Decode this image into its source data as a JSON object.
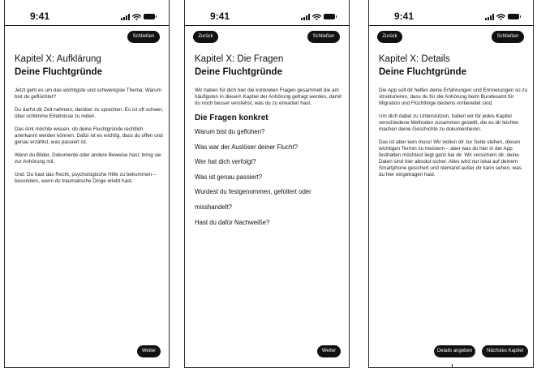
{
  "status": {
    "time": "9:41"
  },
  "screens": [
    {
      "close_label": "Schließen",
      "chapter": "Kapitel X: Aufklärung",
      "title": "Deine Fluchtgründe",
      "paragraphs": [
        "Jetzt geht es um das wichtigste und schwierigste Thema: Warum bist du geflüchtet?",
        "Du darfst dir Zeit nehmen, darüber zu sprechen. Es ist oft schwer, über schlimme Erlebnisse zu reden.",
        "Das Amt möchte wissen, ob deine Fluchtgründe rechtlich anerkannt werden können. Dafür ist es wichtig, dass du offen und genau erzählst, was passiert ist.",
        "Wenn du Bilder, Dokumente oder andere Beweise hast, bring sie zur Anhörung mit.",
        "Und: Du hast das Recht, psychologische Hilfe zu bekommen – besonders, wenn du traumatische Dinge erlebt hast."
      ],
      "next_label": "Weiter"
    },
    {
      "back_label": "Zurück",
      "close_label": "Schließen",
      "chapter": "Kapitel X: Die Fragen",
      "title": "Deine Fluchtgründe",
      "paragraphs": [
        "Wir haben für dich hier die konkreten Fragen gesammelt die am häufigsten in diesem Kaptiel der Anhörung gefragt werden, damit du noch besser verstehst, was du zu erwarten hast."
      ],
      "subheading": "Die Fragen konkret",
      "questions": [
        "Warum bist du geflohen?",
        "Was war der Auslöser deiner Flucht?",
        "Wer hat dich verfolgt?",
        "Was ist genau passiert?",
        "Wurdest du festgenommen, gefoltert oder",
        "misshandelt?",
        "Hast du dafür Nachweiße?"
      ],
      "next_label": "Weiter"
    },
    {
      "back_label": "Zurück",
      "close_label": "Schließen",
      "chapter": "Kapitel X: Details",
      "title": "Deine Fluchtgründe",
      "paragraphs": [
        "Die App soll dir helfen deine Erfahrungen und Erinnerungen so zu strukturieren, dass du für die Anhörung beim Bundesamt für Migration und Flüchtlinge bestens vorbereitet sind.",
        "Um dich dabei zu Unterstützen, haben wir für jedes Kapitel verschiedene Methoden zusammen gestellt, die es dir leichter machen deine Geschichte zu dokumentieren.",
        "Das ist aber kein muss! Wir wollen dir zur Seite stehen, diesen wichtigen Termin zu meistern – aber was du hier in der App festhalten möchtest liegt ganz bei dir. Wir versichern dir, deine Daten sind hier absolut sicher. Alles wird nur lokal auf deinem Smartphone gesichert und niemand außer dir kann sehen, was du hier eingetragen hast."
      ],
      "details_label": "Details angeben",
      "next_chapter_label": "Nächstes Kapitel"
    }
  ],
  "icons": {
    "signal": "cellular-signal-icon",
    "wifi": "wifi-icon",
    "battery": "battery-icon"
  }
}
